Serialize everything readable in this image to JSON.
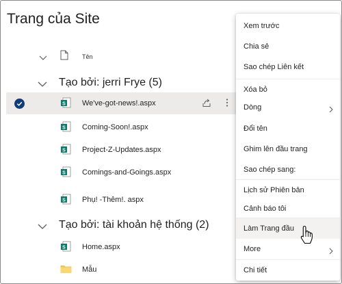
{
  "page": {
    "title": "Trang của Site"
  },
  "list": {
    "column_name": "Tên",
    "groups": [
      {
        "label": "Tạo bởi: jerri Frye (5)",
        "items": [
          {
            "name": "We've-got-news!.aspx",
            "selected": true,
            "icon": "sitepage-icon"
          },
          {
            "name": "Coming-Soon!.aspx",
            "selected": false,
            "icon": "sitepage-icon"
          },
          {
            "name": "Project-Z-Updates.aspx",
            "selected": false,
            "icon": "sitepage-icon"
          },
          {
            "name": "Comings-and-Goings.aspx",
            "selected": false,
            "icon": "sitepage-icon"
          },
          {
            "name": "Phụ! -Thêm!. aspx",
            "selected": false,
            "icon": "sitepage-icon"
          }
        ]
      },
      {
        "label": "Tạo bởi: tài khoản hệ thống (2)",
        "items": [
          {
            "name": "Home.aspx",
            "selected": false,
            "icon": "sitepage-icon"
          },
          {
            "name": "Mẫu",
            "selected": false,
            "icon": "folder-icon"
          }
        ]
      }
    ]
  },
  "context_menu": {
    "items": [
      {
        "label": "Xem trước"
      },
      {
        "label": "Chia sẻ"
      },
      {
        "label": "Sao chép Liên kết"
      },
      {
        "label": "Xóa bỏ"
      },
      {
        "label": "Dòng",
        "submenu": true
      },
      {
        "label": "Đổi tên"
      },
      {
        "label": "Ghim lên đầu trang"
      },
      {
        "label": "Sao chép sang:"
      },
      {
        "label": "Lịch sử Phiên bản"
      },
      {
        "label": "Cảnh báo tôi"
      },
      {
        "label": "Làm Trang đầu",
        "hover": true
      },
      {
        "label": "More",
        "submenu": true
      },
      {
        "label": "Chi tiết"
      }
    ]
  },
  "colors": {
    "accent": "#0f3d7a",
    "sitepage_icon": "#0f7b6c",
    "folder": "#f2c046"
  }
}
